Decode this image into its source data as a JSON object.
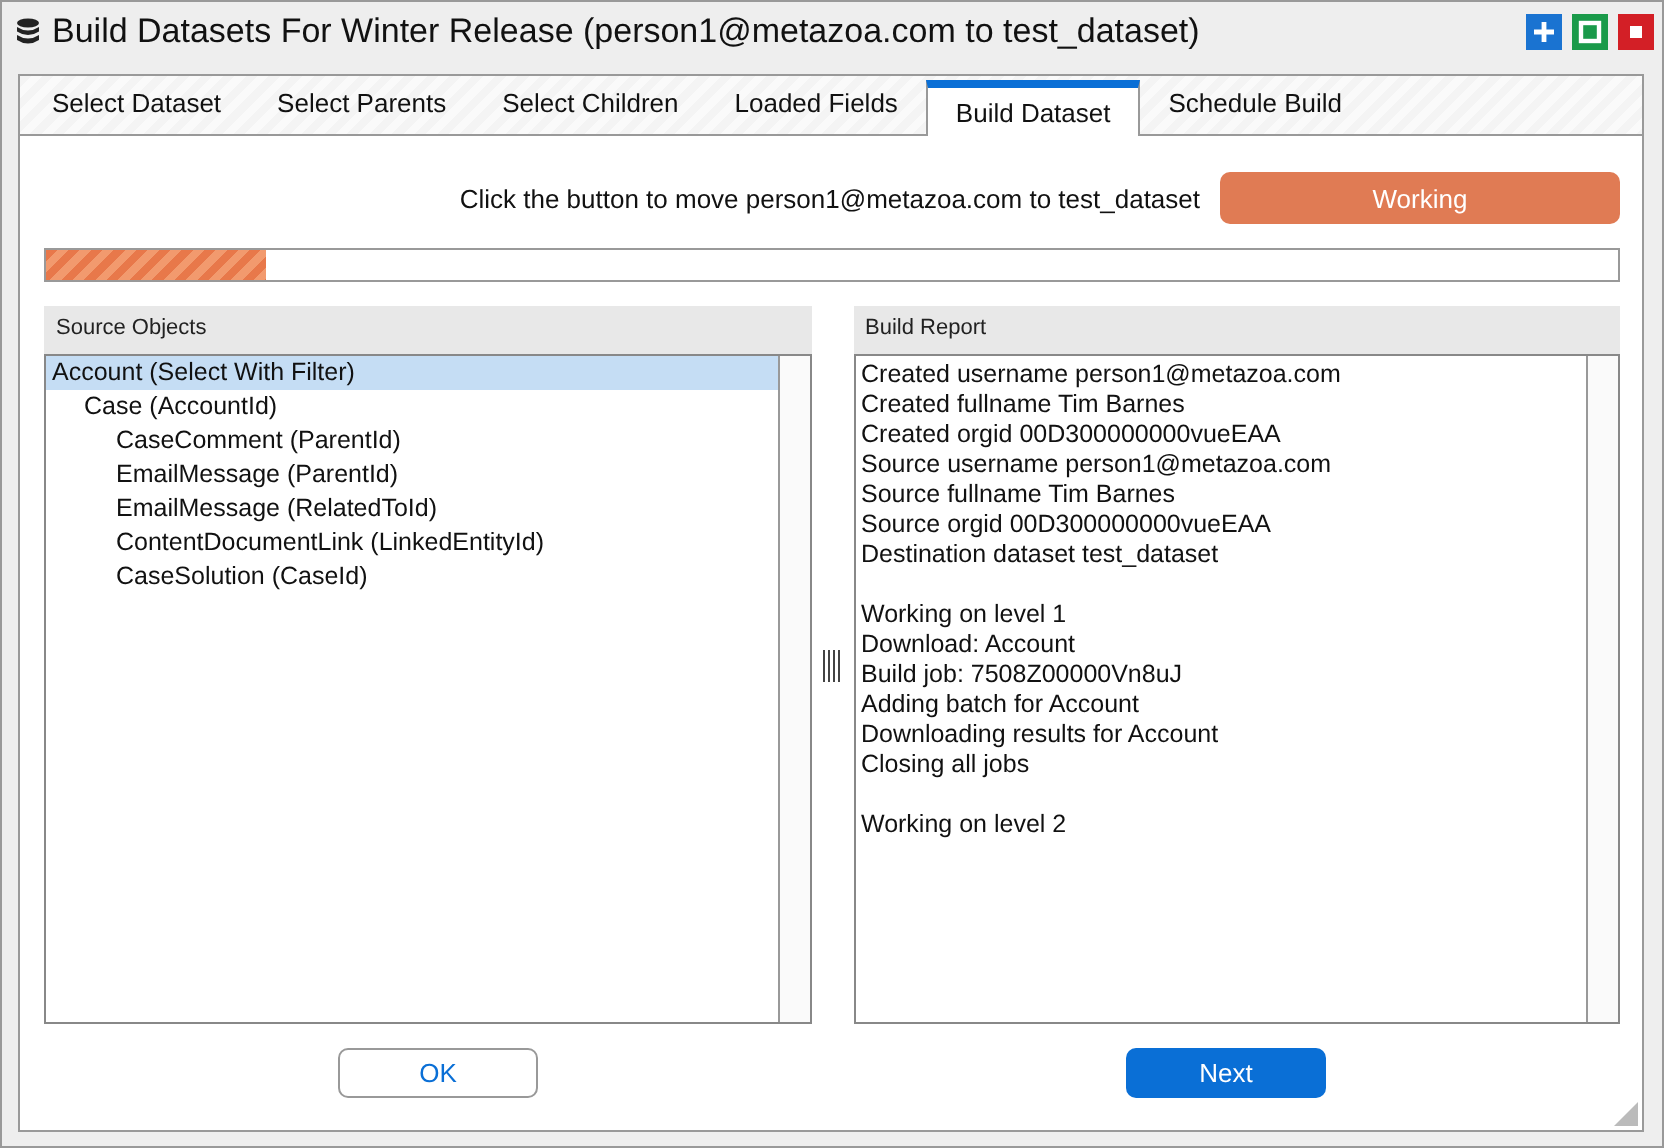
{
  "window": {
    "title": "Build Datasets For Winter Release (person1@metazoa.com to test_dataset)"
  },
  "tabs": [
    {
      "label": "Select Dataset",
      "selected": false
    },
    {
      "label": "Select Parents",
      "selected": false
    },
    {
      "label": "Select Children",
      "selected": false
    },
    {
      "label": "Loaded Fields",
      "selected": false
    },
    {
      "label": "Build Dataset",
      "selected": true
    },
    {
      "label": "Schedule Build",
      "selected": false
    }
  ],
  "instruction": "Click the button to move person1@metazoa.com to test_dataset",
  "action_button": {
    "label": "Working"
  },
  "progress": {
    "level": 0.14
  },
  "source_objects": {
    "title": "Source Objects",
    "items": [
      {
        "label": "Account (Select With Filter)",
        "selected": true,
        "children": [
          {
            "label": "Case (AccountId)",
            "selected": false,
            "children": [
              {
                "label": "CaseComment (ParentId)",
                "selected": false
              },
              {
                "label": "EmailMessage (ParentId)",
                "selected": false
              },
              {
                "label": "EmailMessage (RelatedToId)",
                "selected": false
              },
              {
                "label": "ContentDocumentLink (LinkedEntityId)",
                "selected": false
              },
              {
                "label": "CaseSolution (CaseId)",
                "selected": false
              }
            ]
          }
        ]
      }
    ]
  },
  "build_report": {
    "title": "Build Report",
    "paragraphs": [
      [
        "Created username person1@metazoa.com",
        "Created fullname Tim Barnes",
        "Created orgid 00D300000000vueEAA",
        "Source username person1@metazoa.com",
        "Source fullname Tim Barnes",
        "Source orgid 00D300000000vueEAA",
        "Destination dataset test_dataset"
      ],
      [
        "Working on level 1",
        "Download: Account",
        "Build job: 7508Z00000Vn8uJ",
        "Adding batch for Account",
        "Downloading results for Account",
        "Closing all jobs"
      ],
      [
        "Working on level 2"
      ]
    ]
  },
  "buttons": [
    {
      "label": "OK",
      "kind": "secondary"
    },
    {
      "label": "Next",
      "kind": "primary"
    }
  ]
}
